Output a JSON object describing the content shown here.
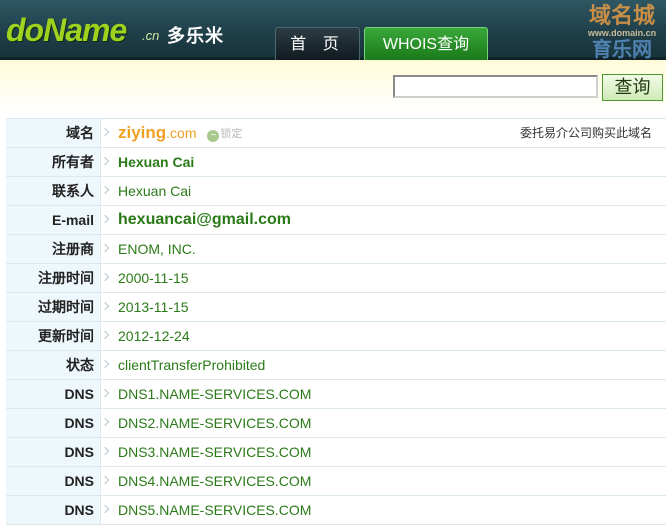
{
  "header": {
    "logo": "doName",
    "logo_suffix": ".cn",
    "brand": "多乐米",
    "nav": [
      {
        "label": "首 页"
      },
      {
        "label": "WHOIS查询"
      }
    ],
    "watermark": {
      "line1": "域名城",
      "line2": "www.domain.cn",
      "line3": "育乐网"
    }
  },
  "search": {
    "value": "",
    "button_label": "查询"
  },
  "whois": {
    "domain_name": "ziying",
    "domain_tld": ".com",
    "lock_label": "锁定",
    "buy_link": "委托易介公司购买此域名",
    "rows": [
      {
        "label": "域名"
      },
      {
        "label": "所有者",
        "value": "Hexuan Cai"
      },
      {
        "label": "联系人",
        "value": "Hexuan Cai"
      },
      {
        "label": "E-mail",
        "value": "hexuancai@gmail.com"
      },
      {
        "label": "注册商",
        "value": "ENOM, INC."
      },
      {
        "label": "注册时间",
        "value": "2000-11-15"
      },
      {
        "label": "过期时间",
        "value": "2013-11-15"
      },
      {
        "label": "更新时间",
        "value": "2012-12-24"
      },
      {
        "label": "状态",
        "value": "clientTransferProhibited"
      },
      {
        "label": "DNS",
        "value": "DNS1.NAME-SERVICES.COM"
      },
      {
        "label": "DNS",
        "value": "DNS2.NAME-SERVICES.COM"
      },
      {
        "label": "DNS",
        "value": "DNS3.NAME-SERVICES.COM"
      },
      {
        "label": "DNS",
        "value": "DNS4.NAME-SERVICES.COM"
      },
      {
        "label": "DNS",
        "value": "DNS5.NAME-SERVICES.COM"
      }
    ]
  }
}
